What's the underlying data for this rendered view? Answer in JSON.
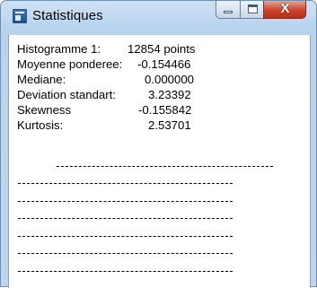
{
  "window": {
    "title": "Statistiques",
    "close_glyph": "X"
  },
  "stats": [
    {
      "label": "Histogramme 1:",
      "value": "12854 points"
    },
    {
      "label": "Moyenne ponderee:",
      "value": "-0.154466"
    },
    {
      "label": "Mediane:",
      "value": "0.000000"
    },
    {
      "label": "Deviation standart:",
      "value": "3.23392"
    },
    {
      "label": "Skewness",
      "value": "-0.155842"
    },
    {
      "label": "Kurtosis:",
      "value": "2.53701"
    }
  ]
}
